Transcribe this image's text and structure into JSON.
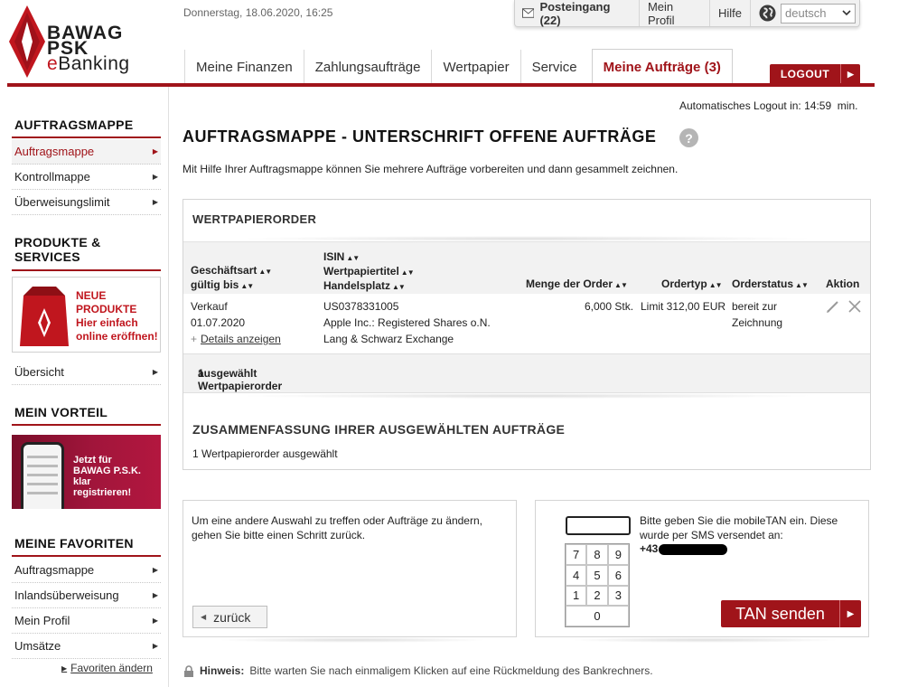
{
  "brand": {
    "line1": "BAWAG",
    "line2": "PSK",
    "line3_prefix": "e",
    "line3_rest": "Banking"
  },
  "header": {
    "datetime": "Donnerstag, 18.06.2020, 16:25",
    "inbox_label": "Posteingang (22)",
    "profile_label": "Mein Profil",
    "help_label": "Hilfe",
    "language": "deutsch",
    "logout_label": "LOGOUT"
  },
  "tabs": [
    {
      "label": "Meine Finanzen"
    },
    {
      "label": "Zahlungsaufträge"
    },
    {
      "label": "Wertpapier"
    },
    {
      "label": "Service"
    },
    {
      "label": "Meine Aufträge (3)"
    }
  ],
  "sidebar": {
    "section1": {
      "title": "AUFTRAGSMAPPE",
      "items": [
        {
          "label": "Auftragsmappe"
        },
        {
          "label": "Kontrollmappe"
        },
        {
          "label": "Überweisungslimit"
        }
      ]
    },
    "section2": {
      "title_line1": "PRODUKTE &",
      "title_line2": "SERVICES",
      "promo_line1": "NEUE",
      "promo_line2": "PRODUKTE",
      "promo_line3": "Hier einfach",
      "promo_line4": "online eröffnen!",
      "items": [
        {
          "label": "Übersicht"
        }
      ]
    },
    "section3": {
      "title": "MEIN VORTEIL",
      "promo_line1": "Jetzt für",
      "promo_line2": "BAWAG P.S.K. klar",
      "promo_line3": "registrieren!"
    },
    "section4": {
      "title": "MEINE FAVORITEN",
      "items": [
        {
          "label": "Auftragsmappe"
        },
        {
          "label": "Inlandsüberweisung"
        },
        {
          "label": "Mein Profil"
        },
        {
          "label": "Umsätze"
        }
      ],
      "edit_link": "Favoriten ändern"
    }
  },
  "main": {
    "autologout_label": "Automatisches Logout in:",
    "autologout_time": "14:59",
    "autologout_unit": "min.",
    "title": "AUFTRAGSMAPPE - UNTERSCHRIFT OFFENE AUFTRÄGE",
    "intro": "Mit Hilfe Ihrer Auftragsmappe können Sie mehrere Aufträge vorbereiten und dann gesammelt zeichnen.",
    "orders": {
      "title": "WERTPAPIERORDER",
      "columns": {
        "col1_line1": "Geschäftsart",
        "col1_line2": "gültig bis",
        "col2_line1": "ISIN",
        "col2_line2": "Wertpapiertitel",
        "col2_line3": "Handelsplatz",
        "col3": "Menge der Order",
        "col4": "Ordertyp",
        "col5": "Orderstatus",
        "col6": "Aktion"
      },
      "rows": [
        {
          "type": "Verkauf",
          "valid_until": "01.07.2020",
          "details_link": "Details anzeigen",
          "isin": "US0378331005",
          "title": "Apple Inc.: Registered Shares o.N.",
          "venue": "Lang & Schwarz Exchange",
          "quantity": "6,000 Stk.",
          "order_type": "Limit 312,00 EUR",
          "status_line1": "bereit zur",
          "status_line2": "Zeichnung"
        }
      ],
      "selected_line1": "1 Wertpapierorder",
      "selected_line2": "ausgewählt"
    },
    "summary": {
      "title": "ZUSAMMENFASSUNG IHRER AUSGEWÄHLTEN AUFTRÄGE",
      "text": "1 Wertpapierorder ausgewählt"
    },
    "back_panel": {
      "text": "Um eine andere Auswahl zu treffen oder Aufträge zu ändern, gehen Sie bitte einen Schritt zurück.",
      "button_label": "zurück"
    },
    "tan_panel": {
      "text": "Bitte geben Sie die mobileTAN ein. Diese wurde per SMS versendet an:",
      "phone_prefix": "+43",
      "keys": [
        "7",
        "8",
        "9",
        "4",
        "5",
        "6",
        "1",
        "2",
        "3",
        "0"
      ],
      "button_label": "TAN senden"
    },
    "hint_label": "Hinweis:",
    "hint_text": "Bitte warten Sie nach einmaligem Klicken auf eine Rückmeldung des Bankrechners."
  },
  "colors": {
    "brand_red": "#a0141a",
    "logo_red": "#c0161e"
  }
}
